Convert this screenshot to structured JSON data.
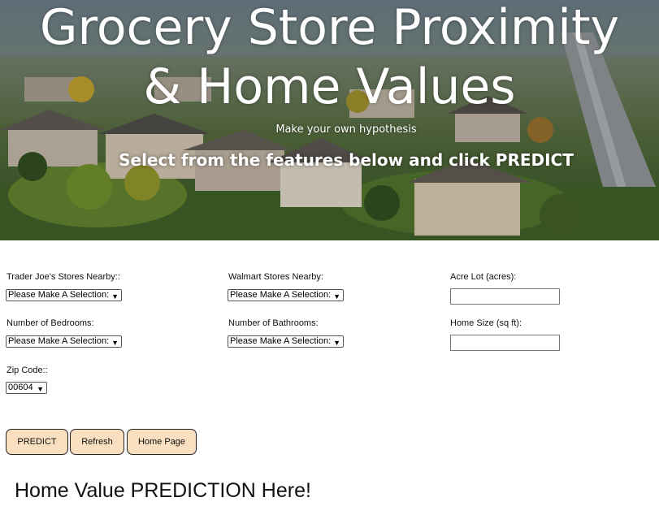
{
  "hero": {
    "title_line1": "Grocery Store Proximity",
    "title_line2": "& Home Values",
    "subtitle": "Make your own hypothesis",
    "instruction": "Select from the features below and click PREDICT"
  },
  "form": {
    "trader_joes": {
      "label": "Trader Joe's Stores Nearby::",
      "selected": "Please Make A Selection:"
    },
    "walmart": {
      "label": "Walmart Stores Nearby:",
      "selected": "Please Make A Selection:"
    },
    "acre_lot": {
      "label": "Acre Lot (acres):",
      "value": ""
    },
    "bedrooms": {
      "label": "Number of Bedrooms:",
      "selected": "Please Make A Selection:"
    },
    "bathrooms": {
      "label": "Number of Bathrooms:",
      "selected": "Please Make A Selection:"
    },
    "home_size": {
      "label": "Home Size (sq ft):",
      "value": ""
    },
    "zip": {
      "label": "Zip Code::",
      "selected": "00604"
    }
  },
  "buttons": {
    "predict": "PREDICT",
    "refresh": "Refresh",
    "home": "Home Page"
  },
  "result": {
    "text": "Home Value PREDICTION Here!"
  },
  "colors": {
    "button_bg": "#f9dfc0"
  }
}
